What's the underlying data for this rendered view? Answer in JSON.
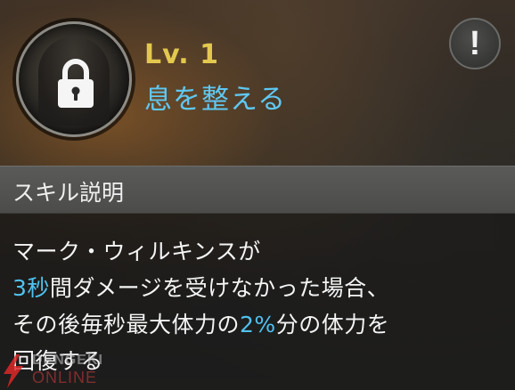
{
  "skill": {
    "level": "Lv. 1",
    "name": "息を整える",
    "locked": true
  },
  "info_button": {
    "label": "!"
  },
  "description_section": {
    "title": "スキル説明",
    "lines": [
      [
        {
          "text": "マーク・ウィルキンスが",
          "highlight": false
        }
      ],
      [
        {
          "text": "3秒",
          "highlight": true
        },
        {
          "text": "間ダメージを受けなかった場合、",
          "highlight": false
        }
      ],
      [
        {
          "text": "その後毎秒最大体力の",
          "highlight": false
        },
        {
          "text": "2%",
          "highlight": true
        },
        {
          "text": "分の体力を",
          "highlight": false
        }
      ],
      [
        {
          "text": "回復する",
          "highlight": false
        }
      ]
    ]
  },
  "watermark": {
    "line1": "DENGEKI",
    "line2": "ONLINE"
  },
  "colors": {
    "level": "#e3c84f",
    "skill_name": "#5fc8f2",
    "highlight": "#4fc2f0",
    "header_bg": "#4c4c4a"
  }
}
